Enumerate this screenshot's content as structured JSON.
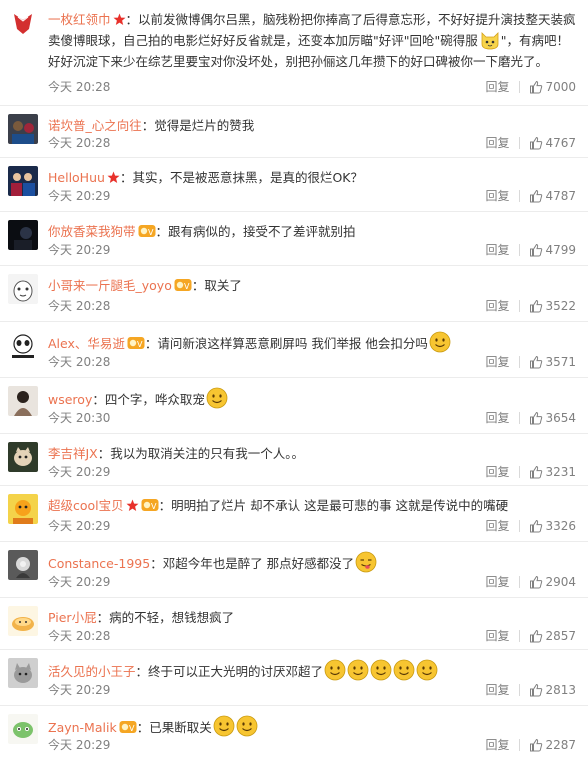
{
  "comments": [
    {
      "username": "一枚红领巾",
      "text": "以前发微博偶尔吕黑，脑残粉把你捧高了后得意忘形，不好好提升演技整天装疯卖傻博眼球，自己拍的电影烂好好反省就是，还变本加厉瞄\"好评\"回呛\"碗得服",
      "text2": "\"，有病吧！好好沉淀下来少在综艺里要宝对你没坏处，别把孙俪这几年攒下的好口碑被你一下磨光了。",
      "time": "今天 20:28",
      "reply": "回复",
      "likes": "7000",
      "badges": [
        "red-star-badge"
      ],
      "emoticons": [
        "cat-emoji"
      ]
    },
    {
      "username": "诺坎普_心之向往",
      "text": "觉得是烂片的赞我",
      "time": "今天 20:28",
      "reply": "回复",
      "likes": "4767"
    },
    {
      "username": "HelloHuu",
      "text": "其实，不是被恶意抹黑，是真的很烂OK？",
      "time": "今天 20:29",
      "reply": "回复",
      "likes": "4787",
      "badges": [
        "red-star-badge"
      ]
    },
    {
      "username": "你放香菜我狗带",
      "text": "跟有病似的，接受不了差评就别拍",
      "time": "今天 20:29",
      "reply": "回复",
      "likes": "4799",
      "badges": [
        "member-badge"
      ]
    },
    {
      "username": "小哥来一斤腿毛_yoyo",
      "text": "取关了",
      "time": "今天 20:28",
      "reply": "回复",
      "likes": "3522",
      "badges": [
        "member-badge"
      ]
    },
    {
      "username": "Alex、华易逝",
      "text": "请问新浪这样算恶意刷屏吗 我们举报 他会扣分吗",
      "time": "今天 20:28",
      "reply": "回复",
      "likes": "3571",
      "badges": [
        "member-badge"
      ],
      "emoticons": [
        "smile-emoji"
      ]
    },
    {
      "username": "wseroy",
      "text": "四个字，哗众取宠",
      "time": "今天 20:30",
      "reply": "回复",
      "likes": "3654",
      "emoticons": [
        "smile-emoji"
      ]
    },
    {
      "username": "李吉祥JX",
      "text": "我以为取消关注的只有我一个人。。",
      "time": "今天 20:29",
      "reply": "回复",
      "likes": "3231"
    },
    {
      "username": "超级cool宝贝",
      "text": "明明拍了烂片 却不承认 这是最可悲的事 这就是传说中的嘴硬",
      "time": "今天 20:29",
      "reply": "回复",
      "likes": "3326",
      "badges": [
        "red-star-badge",
        "member-badge"
      ]
    },
    {
      "username": "Constance-1995",
      "text": "邓超今年也是醉了 那点好感都没了",
      "time": "今天 20:29",
      "reply": "回复",
      "likes": "2904",
      "emoticons": [
        "tongue-emoji"
      ]
    },
    {
      "username": "Pier小屁",
      "text": "病的不轻，想钱想疯了",
      "time": "今天 20:28",
      "reply": "回复",
      "likes": "2857"
    },
    {
      "username": "活久见的小王子",
      "text": "终于可以正大光明的讨厌邓超了",
      "time": "今天 20:29",
      "reply": "回复",
      "likes": "2813",
      "emoticons": [
        "smile-emoji",
        "smile-emoji",
        "smile-emoji",
        "smile-emoji",
        "smile-emoji"
      ]
    },
    {
      "username": "Zayn-Malik",
      "text": "已果断取关",
      "time": "今天 20:29",
      "reply": "回复",
      "likes": "2287",
      "badges": [
        "member-badge"
      ],
      "emoticons": [
        "smile-emoji",
        "smile-emoji"
      ]
    }
  ],
  "colors": {
    "username": "#eb7350",
    "meta_text": "#808080",
    "divider": "#ececec",
    "emoji_yellow": "#f7c531",
    "star_red": "#e8312b"
  }
}
